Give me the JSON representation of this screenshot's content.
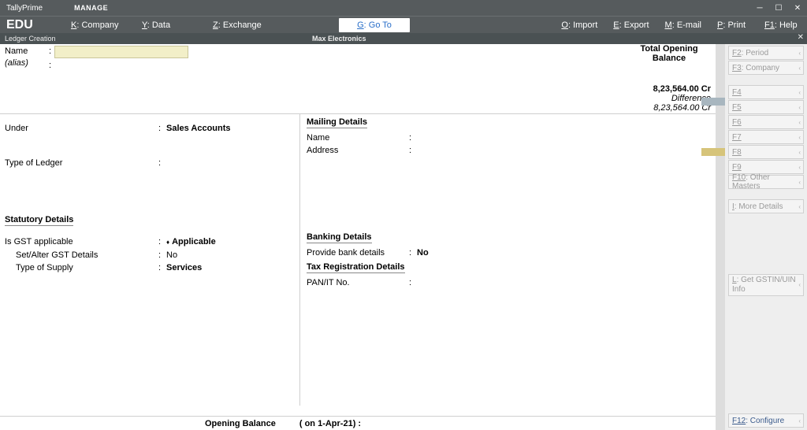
{
  "app": {
    "brand_top": "TallyPrime",
    "brand": "EDU",
    "manage": "MANAGE"
  },
  "menu": {
    "company": {
      "key": "K",
      "label": "Company"
    },
    "data": {
      "key": "Y",
      "label": "Data"
    },
    "exchange": {
      "key": "Z",
      "label": "Exchange"
    },
    "goto": {
      "key": "G",
      "label": "Go To"
    },
    "import": {
      "key": "O",
      "label": "Import"
    },
    "export": {
      "key": "E",
      "label": "Export"
    },
    "email": {
      "key": "M",
      "label": "E-mail"
    },
    "print": {
      "key": "P",
      "label": "Print"
    },
    "help": {
      "key": "F1",
      "label": "Help"
    }
  },
  "subheader": {
    "left": "Ledger Creation",
    "center": "Max Electronics"
  },
  "form": {
    "name_label": "Name",
    "alias_label": "(alias)",
    "under_label": "Under",
    "under_value": "Sales Accounts",
    "type_ledger_label": "Type of Ledger",
    "statutory_header": "Statutory Details",
    "gst_applicable_label": "Is GST applicable",
    "gst_applicable_value": "Applicable",
    "set_alter_label": "Set/Alter GST Details",
    "set_alter_value": "No",
    "type_supply_label": "Type of Supply",
    "type_supply_value": "Services",
    "mailing_header": "Mailing Details",
    "mail_name_label": "Name",
    "mail_address_label": "Address",
    "banking_header": "Banking Details",
    "provide_bank_label": "Provide bank details",
    "provide_bank_value": "No",
    "tax_reg_header": "Tax Registration Details",
    "panit_label": "PAN/IT No.",
    "opening_balance_label": "Opening Balance",
    "opening_balance_date": "( on 1-Apr-21)  :"
  },
  "tob": {
    "header": "Total Opening Balance",
    "amount": "8,23,564.00 Cr",
    "diff_label": "Difference",
    "diff_amount": "8,23,564.00 Cr"
  },
  "rp": {
    "f2": {
      "key": "F2",
      "text": "Period"
    },
    "f3": {
      "key": "F3",
      "text": "Company"
    },
    "f4": {
      "key": "F4",
      "text": ""
    },
    "f5": {
      "key": "F5",
      "text": ""
    },
    "f6": {
      "key": "F6",
      "text": ""
    },
    "f7": {
      "key": "F7",
      "text": ""
    },
    "f8": {
      "key": "F8",
      "text": ""
    },
    "f9": {
      "key": "F9",
      "text": ""
    },
    "f10": {
      "key": "F10",
      "text": "Other Masters"
    },
    "more": {
      "key": "I",
      "text": "More Details"
    },
    "gstin": {
      "key": "L",
      "text": "Get GSTIN/UIN Info"
    },
    "f12": {
      "key": "F12",
      "text": "Configure"
    }
  }
}
